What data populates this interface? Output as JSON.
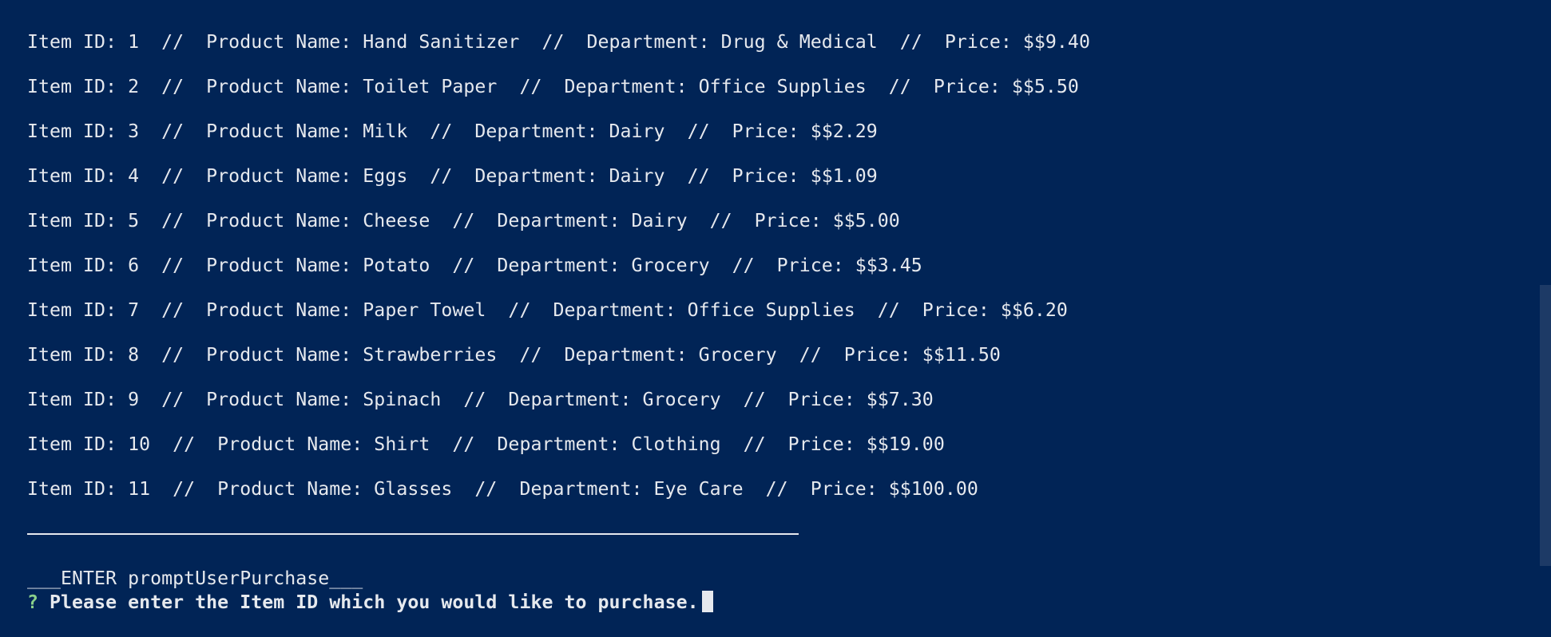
{
  "terminal": {
    "top_dots": "···················",
    "items": [
      "Item ID: 1  //  Product Name: Hand Sanitizer  //  Department: Drug & Medical  //  Price: $$9.40",
      "Item ID: 2  //  Product Name: Toilet Paper  //  Department: Office Supplies  //  Price: $$5.50",
      "Item ID: 3  //  Product Name: Milk  //  Department: Dairy  //  Price: $$2.29",
      "Item ID: 4  //  Product Name: Eggs  //  Department: Dairy  //  Price: $$1.09",
      "Item ID: 5  //  Product Name: Cheese  //  Department: Dairy  //  Price: $$5.00",
      "Item ID: 6  //  Product Name: Potato  //  Department: Grocery  //  Price: $$3.45",
      "Item ID: 7  //  Product Name: Paper Towel  //  Department: Office Supplies  //  Price: $$6.20",
      "Item ID: 8  //  Product Name: Strawberries  //  Department: Grocery  //  Price: $$11.50",
      "Item ID: 9  //  Product Name: Spinach  //  Department: Grocery  //  Price: $$7.30",
      "Item ID: 10  //  Product Name: Shirt  //  Department: Clothing  //  Price: $$19.00",
      "Item ID: 11  //  Product Name: Glasses  //  Department: Eye Care  //  Price: $$100.00"
    ],
    "enter_line": "___ENTER promptUserPurchase___",
    "prompt_mark": "?",
    "prompt_text": " Please enter the Item ID which you would like to purchase."
  },
  "colors": {
    "background": "#012456",
    "text": "#e6e9ee",
    "prompt_mark": "#8bd18b"
  }
}
